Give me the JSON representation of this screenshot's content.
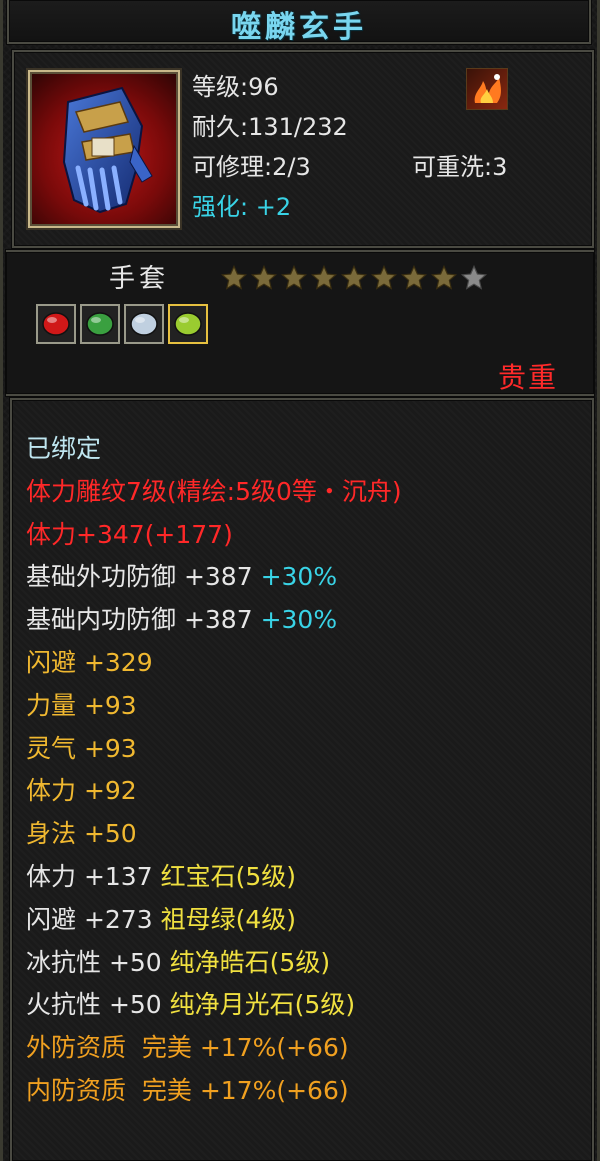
{
  "item": {
    "name": "噬麟玄手",
    "icon": "blue-gauntlet-icon",
    "level_label": "等级",
    "level_value": "96",
    "durability_label": "耐久",
    "durability_value": "131/232",
    "repair_label": "可修理",
    "repair_value": "2/3",
    "rewash_label": "可重洗",
    "rewash_value": "3",
    "enhance_label": "强化:",
    "enhance_value": "+2",
    "skill_icon": "flame-skill-icon",
    "type": "手套",
    "stars": {
      "filled": 8,
      "total": 9
    },
    "gem_slots": [
      {
        "icon": "red-ruby-gem-icon",
        "color": "#d01818"
      },
      {
        "icon": "green-emerald-gem-icon",
        "color": "#3aa040"
      },
      {
        "icon": "white-diamond-gem-icon",
        "color": "#c0d0e0"
      },
      {
        "icon": "green-moonstone-gem-icon",
        "color": "#9acc30",
        "selected": true
      }
    ],
    "rarity": "贵重"
  },
  "attributes": [
    {
      "text": "已绑定",
      "color": "#bfe6f0"
    },
    {
      "text": "体力雕纹7级(精绘:5级0等・沉舟)",
      "color": "#ff2828"
    },
    {
      "text": "体力+347(+177)",
      "color": "#ff2828"
    },
    {
      "text": "基础外功防御 +387 ",
      "color": "#e6e6e6",
      "extra": "+30%",
      "extra_color": "#39d3e6"
    },
    {
      "text": "基础内功防御 +387 ",
      "color": "#e6e6e6",
      "extra": "+30%",
      "extra_color": "#39d3e6"
    },
    {
      "text": "闪避 +329",
      "color": "#f0b830"
    },
    {
      "text": "力量 +93",
      "color": "#f0b830"
    },
    {
      "text": "灵气 +93",
      "color": "#f0b830"
    },
    {
      "text": "体力 +92",
      "color": "#f0b830"
    },
    {
      "text": "身法 +50",
      "color": "#f0b830"
    },
    {
      "text": "体力 +137 ",
      "color": "#e6e6e6",
      "extra": "红宝石(5级)",
      "extra_color": "#f0e040"
    },
    {
      "text": "闪避 +273 ",
      "color": "#e6e6e6",
      "extra": "祖母绿(4级)",
      "extra_color": "#f0e040"
    },
    {
      "text": "冰抗性 +50 ",
      "color": "#e6e6e6",
      "extra": "纯净皓石(5级)",
      "extra_color": "#f0e040"
    },
    {
      "text": "火抗性 +50 ",
      "color": "#e6e6e6",
      "extra": "纯净月光石(5级)",
      "extra_color": "#f0e040"
    },
    {
      "text": "外防资质  完美 +17%(+66)",
      "color": "#f0a020"
    },
    {
      "text": "内防资质  完美 +17%(+66)",
      "color": "#f0a020"
    }
  ],
  "colors": {
    "title": "#79d6ef",
    "enhance": "#39d3e6",
    "rarity": "#ff2a2a",
    "star_filled": "#7a6a3a",
    "star_empty": "#8a8a8a"
  }
}
